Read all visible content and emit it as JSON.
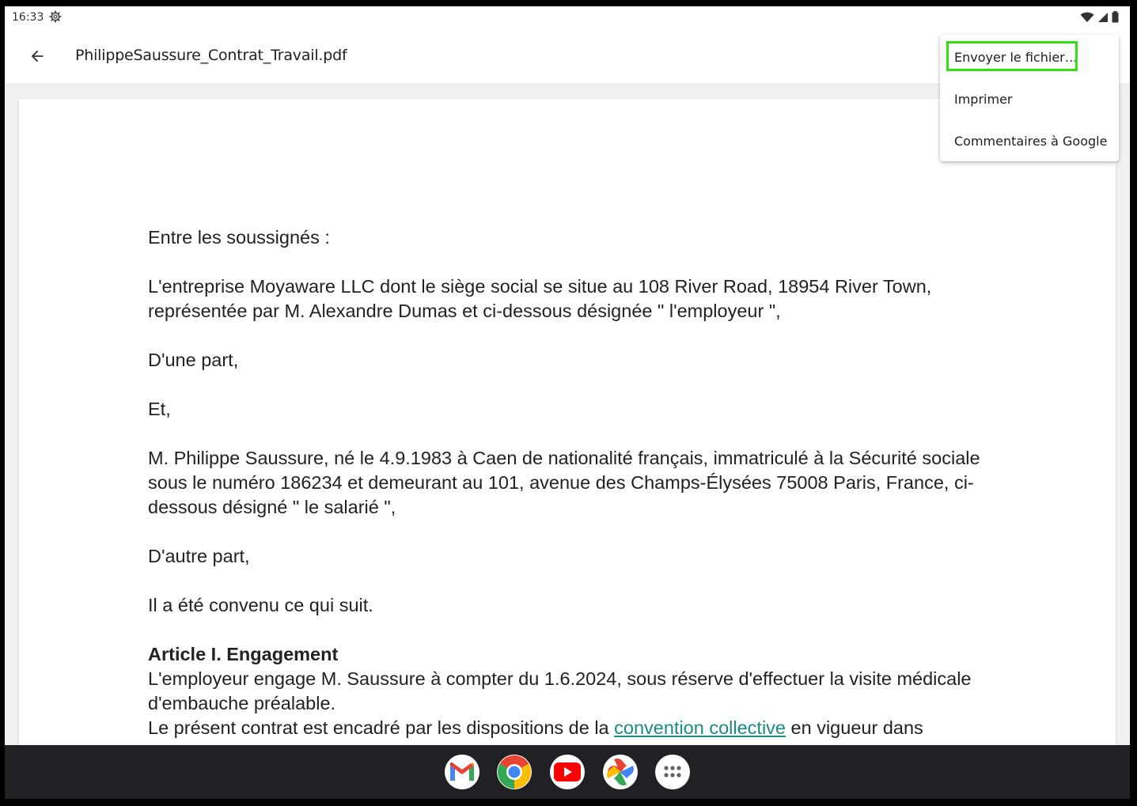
{
  "status_bar": {
    "time": "16:33",
    "settings_icon": "gear-icon",
    "icons": [
      "wifi-icon",
      "signal-icon",
      "battery-icon"
    ]
  },
  "app_bar": {
    "back_icon": "arrow-back-icon",
    "title": "PhilippeSaussure_Contrat_Travail.pdf"
  },
  "menu": {
    "items": [
      {
        "label": "Envoyer le fichier…"
      },
      {
        "label": "Imprimer"
      },
      {
        "label": "Commentaires à Google"
      }
    ],
    "highlight_color": "#33e014"
  },
  "document": {
    "p1": "Entre les soussignés :",
    "p2": "L'entreprise Moyaware LLC dont le siège social se situe au 108 River Road, 18954 River Town, représentée par M. Alexandre Dumas et ci-dessous désignée \" l'employeur \",",
    "p3": "D'une part,",
    "p4": "Et,",
    "p5": "M. Philippe Saussure, né le 4.9.1983 à Caen de nationalité français, immatriculé à la Sécurité sociale sous le numéro 186234 et demeurant au 101, avenue des Champs-Élysées 75008 Paris, France, ci-dessous désigné \" le salarié \",",
    "p6": "D'autre part,",
    "p7": "Il a été convenu ce qui suit.",
    "article_heading": "Article I. Engagement",
    "article_p1": "L'employeur engage M. Saussure à compter du 1.6.2024, sous réserve d'effectuer la visite médicale d'embauche préalable.",
    "article_p2_before": "Le présent contrat est encadré par les dispositions de la ",
    "article_p2_link": "convention collective",
    "article_p2_after": " en vigueur dans",
    "link_color": "#1a8a84"
  },
  "dock": {
    "apps": [
      {
        "name": "Gmail",
        "icon": "gmail-icon"
      },
      {
        "name": "Chrome",
        "icon": "chrome-icon"
      },
      {
        "name": "YouTube",
        "icon": "youtube-icon"
      },
      {
        "name": "Photos",
        "icon": "photos-icon"
      },
      {
        "name": "Apps",
        "icon": "app-drawer-icon"
      }
    ]
  }
}
